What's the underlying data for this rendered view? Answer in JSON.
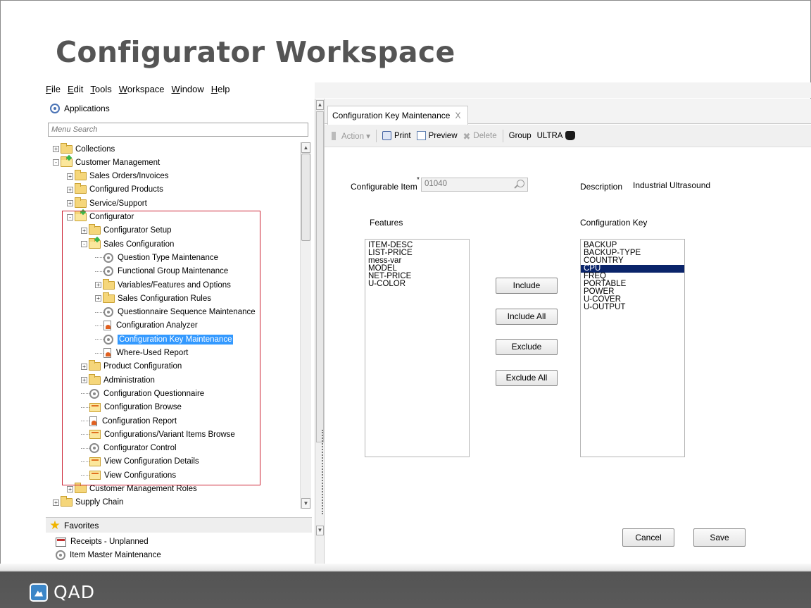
{
  "slide": {
    "title": "Configurator Workspace",
    "logo_text": "QAD"
  },
  "menubar": [
    "File",
    "Edit",
    "Tools",
    "Workspace",
    "Window",
    "Help"
  ],
  "left_panel": {
    "applications_label": "Applications",
    "search_placeholder": "Menu Search",
    "tree": [
      {
        "label": "Collections",
        "icon": "folder-icon",
        "expander": "+"
      },
      {
        "label": "Customer Management",
        "icon": "folder-open-icon",
        "expander": "-"
      },
      {
        "label": "Sales Orders/Invoices",
        "icon": "folder-icon",
        "expander": "+"
      },
      {
        "label": "Configured Products",
        "icon": "folder-icon",
        "expander": "+"
      },
      {
        "label": "Service/Support",
        "icon": "folder-icon",
        "expander": "+"
      },
      {
        "label": "Configurator",
        "icon": "folder-open-icon",
        "expander": "-"
      },
      {
        "label": "Configurator Setup",
        "icon": "folder-icon",
        "expander": "+"
      },
      {
        "label": "Sales Configuration",
        "icon": "folder-open-icon",
        "expander": "-"
      },
      {
        "label": "Question Type Maintenance",
        "icon": "gear-icon"
      },
      {
        "label": "Functional Group Maintenance",
        "icon": "gear-icon"
      },
      {
        "label": "Variables/Features and Options",
        "icon": "folder-icon",
        "expander": "+"
      },
      {
        "label": "Sales Configuration Rules",
        "icon": "folder-icon",
        "expander": "+"
      },
      {
        "label": "Questionnaire Sequence Maintenance",
        "icon": "gear-icon"
      },
      {
        "label": "Configuration Analyzer",
        "icon": "report-icon"
      },
      {
        "label": "Configuration Key Maintenance",
        "icon": "gear-icon",
        "selected": true
      },
      {
        "label": "Where-Used Report",
        "icon": "report-icon"
      },
      {
        "label": "Product Configuration",
        "icon": "folder-icon",
        "expander": "+"
      },
      {
        "label": "Administration",
        "icon": "folder-icon",
        "expander": "+"
      },
      {
        "label": "Configuration Questionnaire",
        "icon": "gear-icon"
      },
      {
        "label": "Configuration Browse",
        "icon": "browse-icon"
      },
      {
        "label": "Configuration Report",
        "icon": "report-icon"
      },
      {
        "label": "Configurations/Variant Items Browse",
        "icon": "browse-icon"
      },
      {
        "label": "Configurator Control",
        "icon": "gear-icon"
      },
      {
        "label": "View Configuration Details",
        "icon": "browse-icon"
      },
      {
        "label": "View Configurations",
        "icon": "browse-icon"
      },
      {
        "label": "Customer Management Roles",
        "icon": "folder-icon",
        "expander": "+"
      },
      {
        "label": "Supply Chain",
        "icon": "folder-icon",
        "expander": "+"
      }
    ],
    "favorites_label": "Favorites",
    "favorites": [
      {
        "label": "Receipts - Unplanned",
        "icon": "receipt-icon"
      },
      {
        "label": "Item Master Maintenance",
        "icon": "gear-icon"
      }
    ]
  },
  "right_panel": {
    "tab_label": "Configuration Key Maintenance",
    "tab_close": "X",
    "toolbar": {
      "action": "Action ▾",
      "print": "Print",
      "preview": "Preview",
      "delete": "Delete",
      "group": "Group",
      "group_value": "ULTRA"
    },
    "form": {
      "item_label": "Configurable Item",
      "required_mark": "*",
      "item_value": "01040",
      "description_label": "Description",
      "description_value": "Industrial Ultrasound",
      "features_label": "Features",
      "features": [
        "ITEM-DESC",
        "LIST-PRICE",
        "mess-var",
        "MODEL",
        "NET-PRICE",
        "U-COLOR"
      ],
      "key_label": "Configuration Key",
      "key_items": [
        "BACKUP",
        "BACKUP-TYPE",
        "COUNTRY",
        "CPU",
        "FREQ",
        "PORTABLE",
        "POWER",
        "U-COVER",
        "U-OUTPUT"
      ],
      "key_selected": "CPU",
      "include": "Include",
      "include_all": "Include All",
      "exclude": "Exclude",
      "exclude_all": "Exclude All",
      "cancel": "Cancel",
      "save": "Save"
    }
  }
}
